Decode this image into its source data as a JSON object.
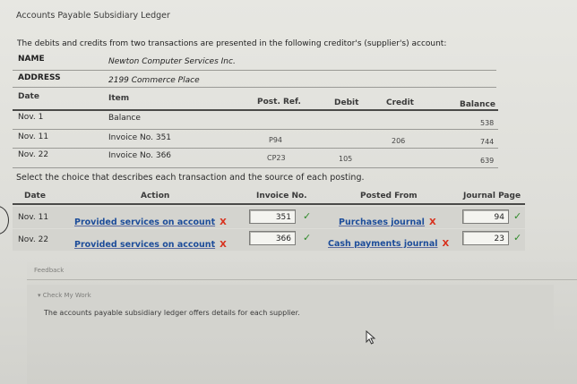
{
  "page": {
    "title": "Accounts Payable Subsidiary Ledger",
    "intro": "The debits and credits from two transactions are presented in the following creditor's (supplier's) account:"
  },
  "account": {
    "name_label": "NAME",
    "name_value": "Newton Computer Services Inc.",
    "address_label": "ADDRESS",
    "address_value": "2199 Commerce Place"
  },
  "ledger": {
    "headers": {
      "date": "Date",
      "item": "Item",
      "post_ref": "Post. Ref.",
      "debit": "Debit",
      "credit": "Credit",
      "balance": "Balance"
    },
    "rows": [
      {
        "date": "Nov. 1",
        "item": "Balance",
        "post_ref": "",
        "debit": "",
        "credit": "",
        "balance": "538"
      },
      {
        "date": "Nov. 11",
        "item": "Invoice No. 351",
        "post_ref": "P94",
        "debit": "",
        "credit": "206",
        "balance": "744"
      },
      {
        "date": "Nov. 22",
        "item": "Invoice No. 366",
        "post_ref": "CP23",
        "debit": "105",
        "credit": "",
        "balance": "639"
      }
    ]
  },
  "question": {
    "prompt": "Select the choice that describes each transaction and the source of each posting.",
    "headers": {
      "date": "Date",
      "action": "Action",
      "invoice": "Invoice No.",
      "posted_from": "Posted From",
      "journal_page": "Journal Page"
    },
    "rows": [
      {
        "date": "Nov. 11",
        "action": "Provided services on account",
        "action_mark": "X",
        "invoice": "351",
        "invoice_mark": "✓",
        "posted_from": "Purchases journal",
        "posted_mark": "X",
        "page": "94",
        "page_mark": "✓"
      },
      {
        "date": "Nov. 22",
        "action": "Provided services on account",
        "action_mark": "X",
        "invoice": "366",
        "invoice_mark": "✓",
        "posted_from": "Cash payments journal",
        "posted_mark": "X",
        "page": "23",
        "page_mark": "✓"
      }
    ]
  },
  "feedback": {
    "label": "Feedback",
    "check_label": "▾ Check My Work",
    "text": "The accounts payable subsidiary ledger offers details for each supplier."
  },
  "colors": {
    "link": "#1d4d9a",
    "error": "#d8301c",
    "correct": "#2f8a2a"
  }
}
